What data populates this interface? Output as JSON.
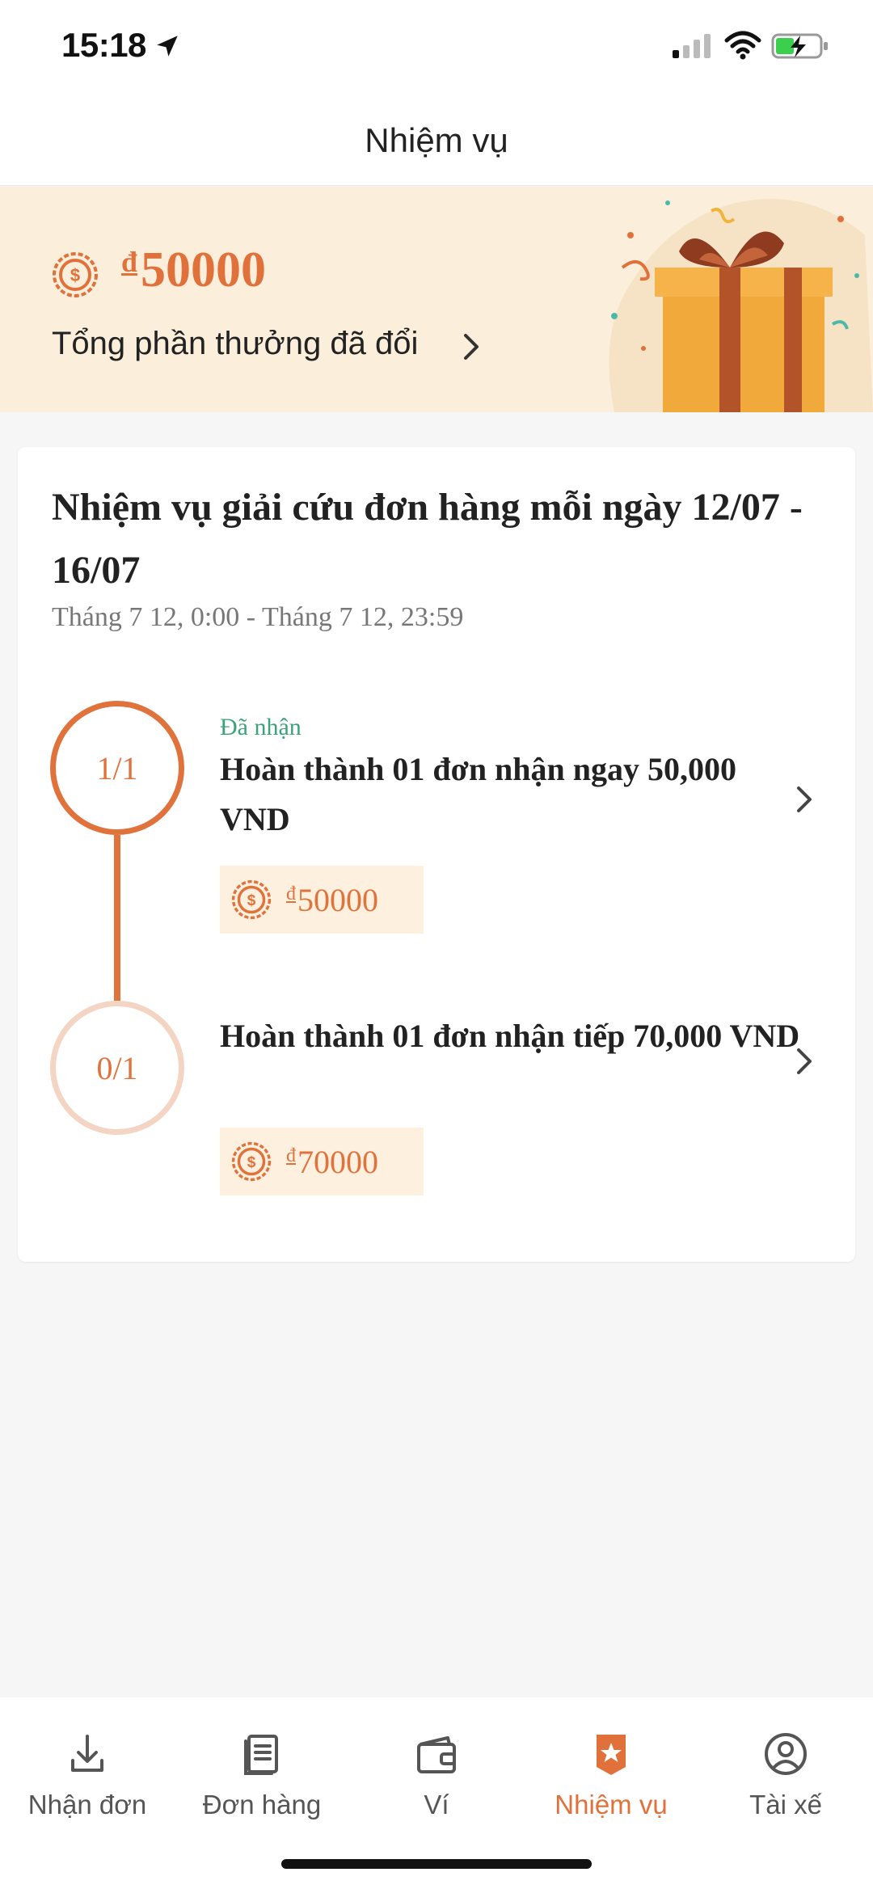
{
  "status_bar": {
    "time": "15:18"
  },
  "header": {
    "title": "Nhiệm vụ"
  },
  "banner": {
    "currency_symbol": "đ",
    "amount": "50000",
    "link_label": "Tổng phần thưởng đã đổi"
  },
  "mission": {
    "title": "Nhiệm vụ giải cứu đơn hàng mỗi ngày 12/07 - 16/07",
    "time_range": "Tháng 7 12, 0:00 - Tháng 7 12, 23:59",
    "tasks": [
      {
        "progress": "1/1",
        "status": "Đã nhận",
        "title": "Hoàn thành 01 đơn nhận ngay 50,000 VND",
        "reward_currency": "đ",
        "reward": "50000"
      },
      {
        "progress": "0/1",
        "status": "",
        "title": "Hoàn thành 01 đơn nhận tiếp 70,000 VND",
        "reward_currency": "đ",
        "reward": "70000"
      }
    ]
  },
  "tabbar": {
    "items": [
      {
        "label": "Nhận đơn",
        "icon": "download-icon"
      },
      {
        "label": "Đơn hàng",
        "icon": "document-icon"
      },
      {
        "label": "Ví",
        "icon": "wallet-icon"
      },
      {
        "label": "Nhiệm vụ",
        "icon": "star-badge-icon",
        "active": true
      },
      {
        "label": "Tài xế",
        "icon": "user-icon"
      }
    ]
  },
  "colors": {
    "accent": "#e1713a",
    "banner_bg": "#fbefdc",
    "chip_bg": "#fdf0de",
    "status_green": "#3aa37a"
  }
}
